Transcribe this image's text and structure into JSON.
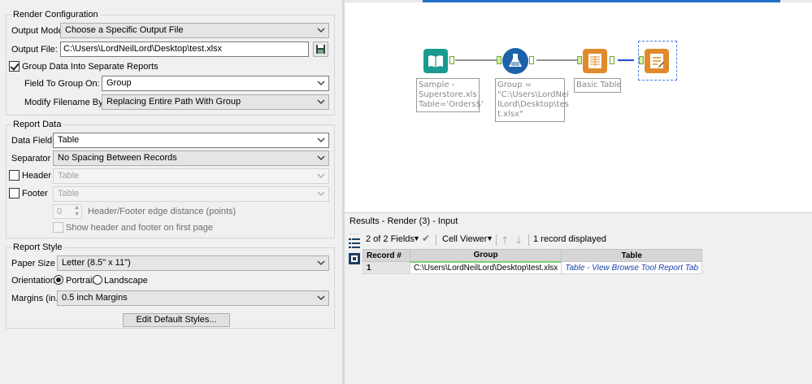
{
  "render_configuration": {
    "title": "Render Configuration",
    "output_mode_label": "Output Mode:",
    "output_mode_value": "Choose a Specific Output File",
    "output_file_label": "Output File:",
    "output_file_value": "C:\\Users\\LordNeilLord\\Desktop\\test.xlsx",
    "group_data_label": "Group Data Into Separate Reports",
    "group_data_checked": true,
    "field_to_group_label": "Field To Group On:",
    "field_to_group_value": "Group",
    "modify_filename_label": "Modify Filename By:",
    "modify_filename_value": "Replacing Entire Path With Group"
  },
  "report_data": {
    "title": "Report Data",
    "data_field_label": "Data Field",
    "data_field_value": "Table",
    "separator_label": "Separator",
    "separator_value": "No Spacing Between Records",
    "header_label": "Header",
    "header_value": "Table",
    "footer_label": "Footer",
    "footer_value": "Table",
    "edge_distance_value": "0",
    "edge_distance_label": "Header/Footer edge distance (points)",
    "show_first_page_label": "Show header and footer on first page"
  },
  "report_style": {
    "title": "Report Style",
    "paper_size_label": "Paper Size",
    "paper_size_value": "Letter (8.5\" x 11\")",
    "orientation_label": "Orientation",
    "portrait_label": "Portrait",
    "landscape_label": "Landscape",
    "orientation_selected": "Portrait",
    "margins_label": "Margins (in.)",
    "margins_value": "0.5 inch Margins",
    "edit_styles_label": "Edit Default Styles..."
  },
  "canvas": {
    "annotations": {
      "input": "Sample -\nSuperstore.xls\nTable='Orders$'",
      "formula": "Group =\n\"C:\\Users\\LordNei\nlLord\\Desktop\\tes\nt.xlsx\"",
      "basic_table": "Basic Table"
    },
    "colors": {
      "input_tool": "#1a9b8f",
      "formula_tool": "#1d62a8",
      "reporting_tool": "#e08a2c",
      "connector": "#555555",
      "selected_connector": "#2b4fd1"
    }
  },
  "results": {
    "title": "Results - Render (3) - Input",
    "fields_label": "2 of 2 Fields",
    "viewer_label": "Cell Viewer",
    "records_label": "1 record displayed",
    "columns": [
      "Record #",
      "Group",
      "Table"
    ],
    "rows": [
      {
        "record": "1",
        "group": "C:\\Users\\LordNeilLord\\Desktop\\test.xlsx",
        "table": "Table - View Browse Tool Report Tab"
      }
    ]
  }
}
